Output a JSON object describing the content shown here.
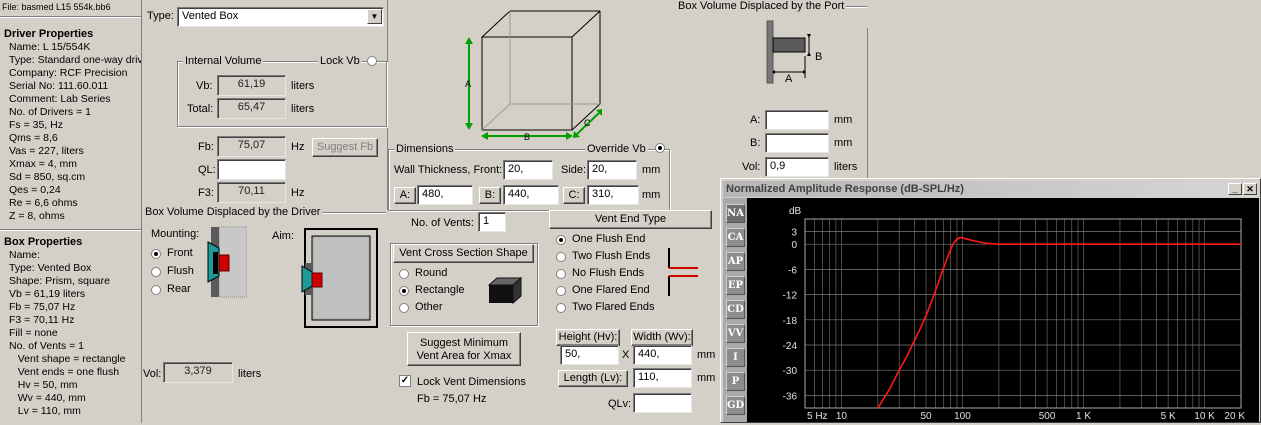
{
  "file_line": "File: basmed L15 554k.bb6",
  "driver": {
    "heading": "Driver Properties",
    "lines": [
      "Name: L 15/554K",
      "Type: Standard one-way drive",
      "Company: RCF Precision",
      "Serial No: 111.60.011",
      "Comment: Lab Series",
      "No. of Drivers = 1",
      "Fs = 35, Hz",
      "Qms = 8,6",
      "Vas = 227, liters",
      "Xmax = 4, mm",
      "Sd = 850, sq.cm",
      "Qes = 0,24",
      "Re = 6,6 ohms",
      "Z = 8, ohms"
    ]
  },
  "box": {
    "heading": "Box Properties",
    "lines": [
      "Name:",
      "Type: Vented Box",
      "Shape: Prism, square",
      "Vb = 61,19 liters",
      "Fb = 75,07 Hz",
      "F3 = 70,11 Hz",
      "Fill = none",
      "No. of Vents = 1",
      "  Vent shape = rectangle",
      "  Vent ends = one flush",
      "  Hv = 50, mm",
      "  Wv = 440, mm",
      "  Lv = 110, mm"
    ]
  },
  "type": {
    "label": "Type:",
    "value": "Vented Box"
  },
  "internal_volume": {
    "title": "Internal Volume",
    "lock_label": "Lock Vb",
    "vb_label": "Vb:",
    "vb_value": "61,19",
    "vb_unit": "liters",
    "total_label": "Total:",
    "total_value": "65,47",
    "total_unit": "liters"
  },
  "tuning": {
    "fb_label": "Fb:",
    "fb_value": "75,07",
    "fb_unit": "Hz",
    "suggest_fb": "Suggest Fb",
    "ql_label": "QL:",
    "ql_value": "",
    "f3_label": "F3:",
    "f3_value": "70,11",
    "f3_unit": "Hz"
  },
  "cube_labels": {
    "a": "A",
    "b": "B",
    "c": "C"
  },
  "driver_displacement": {
    "title": "Box Volume Displaced by the Driver",
    "mounting_label": "Mounting:",
    "options": [
      "Front",
      "Flush",
      "Rear"
    ],
    "selected": "Front",
    "aim_label": "Aim:",
    "vol_label": "Vol:",
    "vol_value": "3,379",
    "vol_unit": "liters"
  },
  "dimensions": {
    "title": "Dimensions",
    "override_label": "Override Vb",
    "wall_label": "Wall Thickness, Front:",
    "wall_front": "20,",
    "side_label": "Side:",
    "wall_side": "20,",
    "wall_unit": "mm",
    "a_label": "A:",
    "a_value": "480,",
    "b_label": "B:",
    "b_value": "440,",
    "c_label": "C:",
    "c_value": "310,",
    "dim_unit": "mm"
  },
  "vents": {
    "label": "No. of Vents:",
    "value": "1"
  },
  "cross_section": {
    "title": "Vent Cross Section Shape",
    "options": [
      "Round",
      "Rectangle",
      "Other"
    ],
    "selected": "Rectangle"
  },
  "suggest_min": {
    "line1": "Suggest Minimum",
    "line2": "Vent Area for Xmax"
  },
  "lock_vent": {
    "label": "Lock Vent Dimensions",
    "checked": true
  },
  "fb_status": "Fb = 75,07 Hz",
  "vent_end": {
    "title": "Vent End Type",
    "options": [
      "One Flush End",
      "Two Flush Ends",
      "No Flush Ends",
      "One Flared End",
      "Two Flared Ends"
    ],
    "selected": "One Flush End"
  },
  "vent_dims": {
    "height_label": "Height (Hv):",
    "height_value": "50,",
    "width_label": "Width (Wv):",
    "width_value": "440,",
    "x_label": "X",
    "mm1": "mm",
    "length_label": "Length (Lv):",
    "length_value": "110,",
    "mm2": "mm",
    "qlv_label": "QLv:",
    "qlv_value": ""
  },
  "port_displacement": {
    "title": "Box Volume Displaced by the Port",
    "a_diagram": "A",
    "b_diagram": "B",
    "a_label": "A:",
    "a_value": "",
    "a_unit": "mm",
    "b_label": "B:",
    "b_value": "",
    "b_unit": "mm",
    "vol_label": "Vol:",
    "vol_value": "0,9",
    "vol_unit": "liters"
  },
  "chart_window": {
    "title": "Normalized Amplitude Response (dB-SPL/Hz)",
    "min_glyph": "_",
    "close_glyph": "✕",
    "side_buttons": [
      "NA",
      "CA",
      "AP",
      "EP",
      "CD",
      "VV",
      "I",
      "P",
      "GD"
    ],
    "active_button": "NA"
  },
  "colors": {
    "curve": "#ff1a1a",
    "grid": "#7a7a7a",
    "plot_bg": "#000000"
  },
  "chart_data": {
    "type": "line",
    "title": "Normalized Amplitude Response (dB-SPL/Hz)",
    "ylabel": "dB",
    "x_scale": "log",
    "xlim": [
      5,
      20000
    ],
    "ylim": [
      -39,
      6
    ],
    "x_ticks": [
      5,
      10,
      50,
      100,
      500,
      1000,
      5000,
      10000,
      20000
    ],
    "x_tick_labels": [
      "5 Hz",
      "10",
      "50",
      "100",
      "500",
      "1 K",
      "5 K",
      "10 K",
      "20 K"
    ],
    "y_ticks": [
      3,
      0,
      -6,
      -12,
      -18,
      -24,
      -30,
      -36
    ],
    "y_tick_labels": [
      "3",
      "0",
      "-6",
      "-12",
      "-18",
      "-24",
      "-30",
      "-36"
    ],
    "grid": true,
    "series": [
      {
        "x": [
          20,
          25,
          30,
          35,
          40,
          45,
          50,
          55,
          60,
          65,
          70,
          75,
          80,
          85,
          90,
          95,
          100,
          110,
          120,
          140,
          160,
          180,
          200,
          500,
          1000,
          5000,
          10000,
          20000
        ],
        "y": [
          -39,
          -34.5,
          -30,
          -26.5,
          -23,
          -20,
          -17,
          -14,
          -11,
          -8.2,
          -5.6,
          -3.2,
          -1.2,
          0.4,
          1.2,
          1.6,
          1.5,
          1.2,
          0.9,
          0.5,
          0.2,
          0.1,
          0,
          0,
          0,
          0,
          0,
          0
        ]
      }
    ]
  }
}
